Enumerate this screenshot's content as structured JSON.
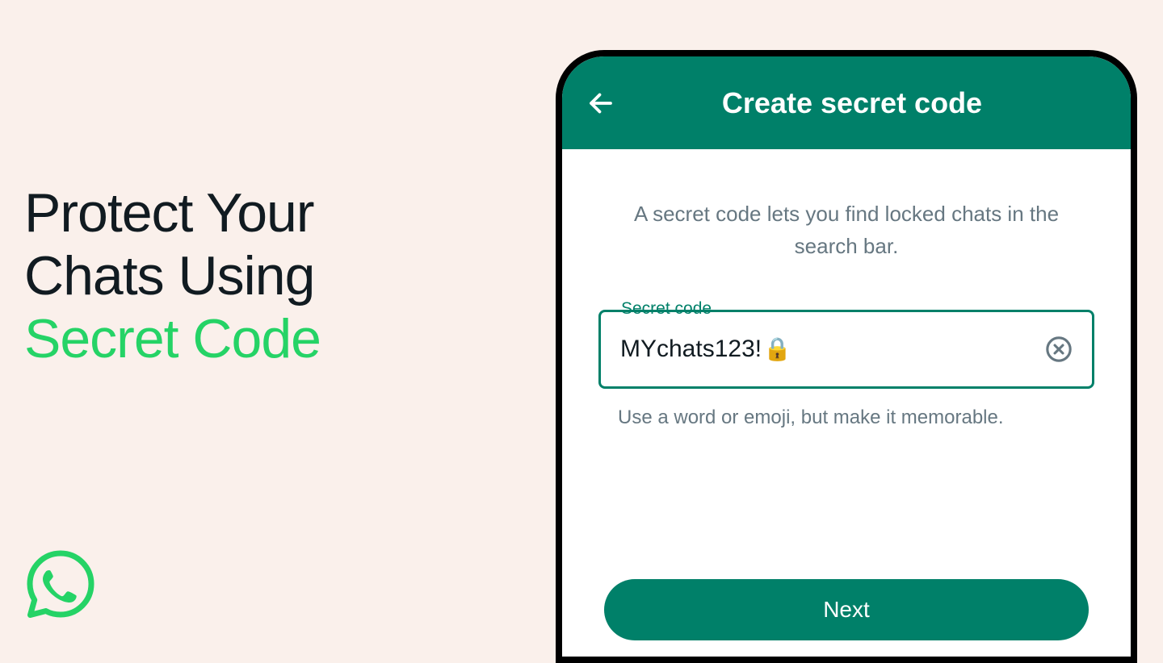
{
  "headline": {
    "line1": "Protect Your",
    "line2": "Chats Using",
    "line3": "Secret Code"
  },
  "logo": {
    "name": "whatsapp-icon"
  },
  "screen": {
    "appbar": {
      "title": "Create secret code"
    },
    "description": "A secret code lets you find locked chats in the search bar.",
    "field": {
      "label": "Secret code",
      "value": "MYchats123!",
      "emoji": "🔒"
    },
    "helper": "Use a word or emoji, but make it memorable.",
    "next_label": "Next"
  },
  "colors": {
    "accent": "#25d366",
    "primary": "#008069",
    "bg": "#faf0eb"
  }
}
